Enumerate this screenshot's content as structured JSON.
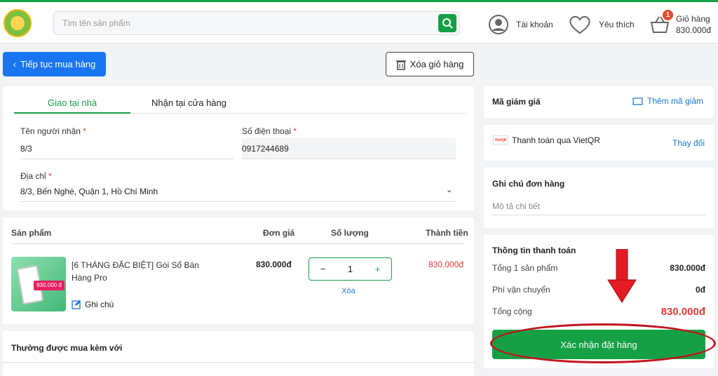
{
  "header": {
    "search_placeholder": "Tìm tên sản phẩm",
    "account_label": "Tài khoản",
    "wishlist_label": "Yêu thích",
    "cart_label": "Giỏ hàng",
    "cart_total": "830.000đ",
    "cart_count": "1"
  },
  "actions": {
    "back_label": "Tiếp tục mua hàng",
    "clear_label": "Xóa giỏ hàng"
  },
  "delivery": {
    "tabs": [
      {
        "label": "Giao tại nhà"
      },
      {
        "label": "Nhận tại cửa hàng"
      }
    ],
    "name_label": "Tên người nhận",
    "name_value": "8/3",
    "phone_label": "Số điện thoại",
    "phone_value": "0917244689",
    "address_label": "Địa chỉ",
    "address_value": "8/3, Bến Nghé, Quận 1, Hồ Chí Minh"
  },
  "cart": {
    "headers": {
      "product": "Sản phẩm",
      "price": "Đơn giá",
      "qty": "Số lượng",
      "total": "Thành tiền"
    },
    "item": {
      "name_line1": "[6 THÁNG   ĐẶC BIỆT] Gói Sổ Bán",
      "name_line2": "Hàng Pro",
      "note_label": "Ghi chú",
      "price": "830.000đ",
      "qty": "1",
      "remove_label": "Xóa",
      "total": "830.000đ"
    }
  },
  "addon": {
    "title": "Thường được mua kèm với"
  },
  "sidebar": {
    "coupon_label": "Mã giảm giá",
    "coupon_add": "Thêm mã giảm",
    "payment_label": "Thanh toán qua VietQR",
    "payment_change": "Thay đổi",
    "payment_logo": "VietQR",
    "note_title": "Ghi chú đơn hàng",
    "note_placeholder": "Mô tả chi tiết",
    "summary_title": "Thông tin thanh toán",
    "rows": [
      {
        "label": "Tổng 1 sản phẩm",
        "value": "830.000đ"
      },
      {
        "label": "Phí vận chuyển",
        "value": "0đ"
      },
      {
        "label": "Tổng cộng",
        "value": "830.000đ"
      }
    ],
    "confirm_label": "Xác nhận đặt hàng"
  },
  "colors": {
    "accent": "#15a045",
    "primary": "#1976f0",
    "price": "#e53935",
    "annotation": "#c0141c"
  }
}
